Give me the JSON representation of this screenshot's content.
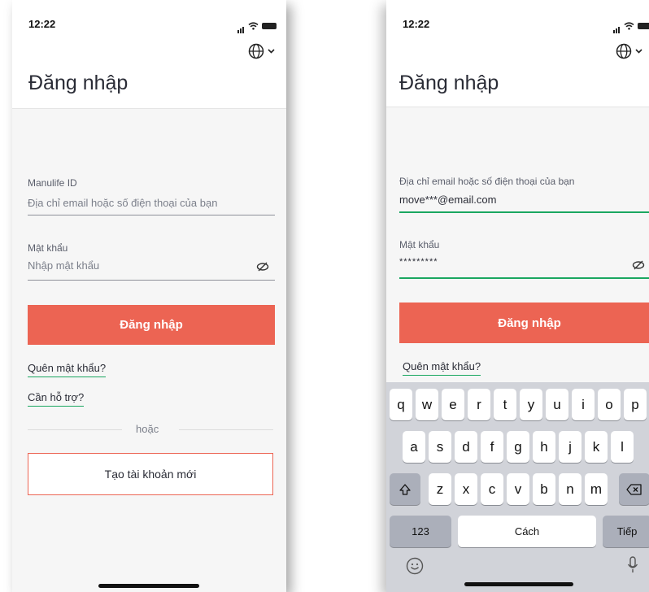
{
  "status": {
    "time": "12:22"
  },
  "left": {
    "title": "Đăng nhập",
    "id_label": "Manulife ID",
    "id_placeholder": "Địa chỉ email hoặc số điện thoại của bạn",
    "password_label": "Mật khẩu",
    "password_placeholder": "Nhập mật khẩu",
    "login_button": "Đăng nhập",
    "forgot_link": "Quên mật khẩu?",
    "help_link": "Cần hỗ trợ?",
    "or_text": "hoặc",
    "create_account_button": "Tạo tài khoản mới"
  },
  "right": {
    "title": "Đăng nhập",
    "id_label": "Địa chỉ email hoặc số điện thoại của bạn",
    "id_value": "move***@email.com",
    "password_label": "Mật khẩu",
    "password_value": "*********",
    "login_button": "Đăng nhập",
    "forgot_link": "Quên mật khẩu?"
  },
  "keyboard": {
    "row1": [
      "q",
      "w",
      "e",
      "r",
      "t",
      "y",
      "u",
      "i",
      "o",
      "p"
    ],
    "row2": [
      "a",
      "s",
      "d",
      "f",
      "g",
      "h",
      "j",
      "k",
      "l"
    ],
    "row3": [
      "z",
      "x",
      "c",
      "v",
      "b",
      "n",
      "m"
    ],
    "numbers_key": "123",
    "space_key": "Cách",
    "return_key": "Tiếp"
  },
  "icons": {
    "globe": "globe-icon",
    "chevron": "chevron-down-icon",
    "eye": "eye-off-icon",
    "shift": "shift-icon",
    "backspace": "backspace-icon",
    "emoji": "emoji-icon",
    "mic": "microphone-icon"
  },
  "colors": {
    "brand": "#ec6453",
    "focus": "#1aa760"
  }
}
